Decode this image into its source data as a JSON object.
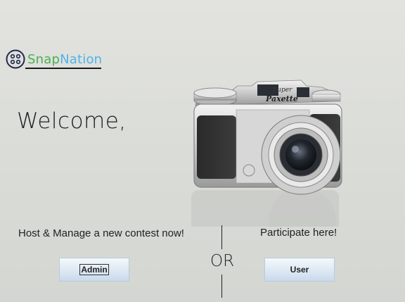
{
  "brand": {
    "part1": "Snap",
    "part2": "Nation",
    "icon": "film-reel-icon",
    "color1": "#4caf50",
    "color2": "#4fb3e8"
  },
  "welcome": "Welcome,",
  "admin_section": {
    "text": "Host & Manage a new contest now!",
    "button_label": "Admin"
  },
  "divider_text": "OR",
  "user_section": {
    "text": "Participate here!",
    "button_label": "User"
  },
  "hero_image": {
    "icon": "camera-image"
  }
}
